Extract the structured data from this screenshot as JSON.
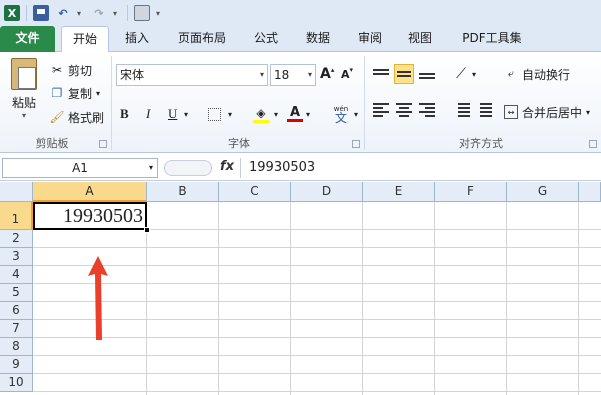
{
  "quick_access": {
    "icons": [
      "excel-logo-icon",
      "save-icon",
      "undo-icon",
      "redo-icon",
      "print-icon"
    ]
  },
  "tabs": [
    {
      "label": "文件"
    },
    {
      "label": "开始"
    },
    {
      "label": "插入"
    },
    {
      "label": "页面布局"
    },
    {
      "label": "公式"
    },
    {
      "label": "数据"
    },
    {
      "label": "审阅"
    },
    {
      "label": "视图"
    },
    {
      "label": "PDF工具集"
    }
  ],
  "ribbon": {
    "clipboard": {
      "paste": "粘贴",
      "cut": "剪切",
      "copy": "复制",
      "format_painter": "格式刷",
      "group_label": "剪贴板"
    },
    "font": {
      "font_name": "宋体",
      "font_size": "18",
      "bold": "B",
      "italic": "I",
      "underline": "U",
      "grow": "A",
      "shrink": "A",
      "font_color": "A",
      "phonetic": "wén",
      "phonetic_char": "文",
      "group_label": "字体"
    },
    "alignment": {
      "wrap_text": "自动换行",
      "merge_center": "合并后居中",
      "group_label": "对齐方式"
    }
  },
  "formula_bar": {
    "name_box": "A1",
    "fx": "fx",
    "content": "19930503"
  },
  "sheet": {
    "columns": [
      "A",
      "B",
      "C",
      "D",
      "E",
      "F",
      "G"
    ],
    "rows": [
      "1",
      "2",
      "3",
      "4",
      "5",
      "6",
      "7",
      "8",
      "9",
      "10"
    ],
    "a1_value": "19930503"
  },
  "colors": {
    "excel_green": "#2a8a4a",
    "selection_header": "#f9d98b",
    "arrow_red": "#e8402a"
  }
}
